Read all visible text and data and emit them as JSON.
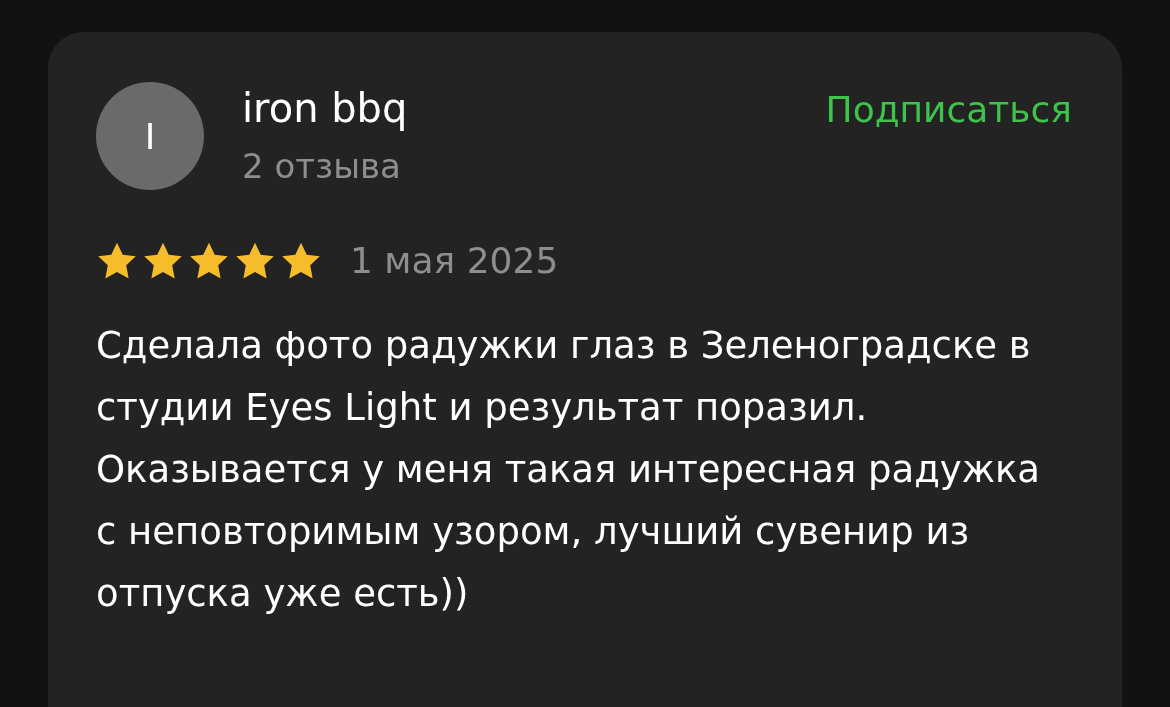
{
  "review": {
    "avatar_letter": "I",
    "author": "iron bbq",
    "review_count": "2 отзыва",
    "subscribe": "Подписаться",
    "stars": 5,
    "date": "1 мая 2025",
    "text": "Сделала фото радужки глаз в Зеленоградске в студии Eyes Light и результат поразил. Оказывается у меня такая интересная радужка с неповторимым узором, лучший сувенир из отпуска уже есть))"
  }
}
